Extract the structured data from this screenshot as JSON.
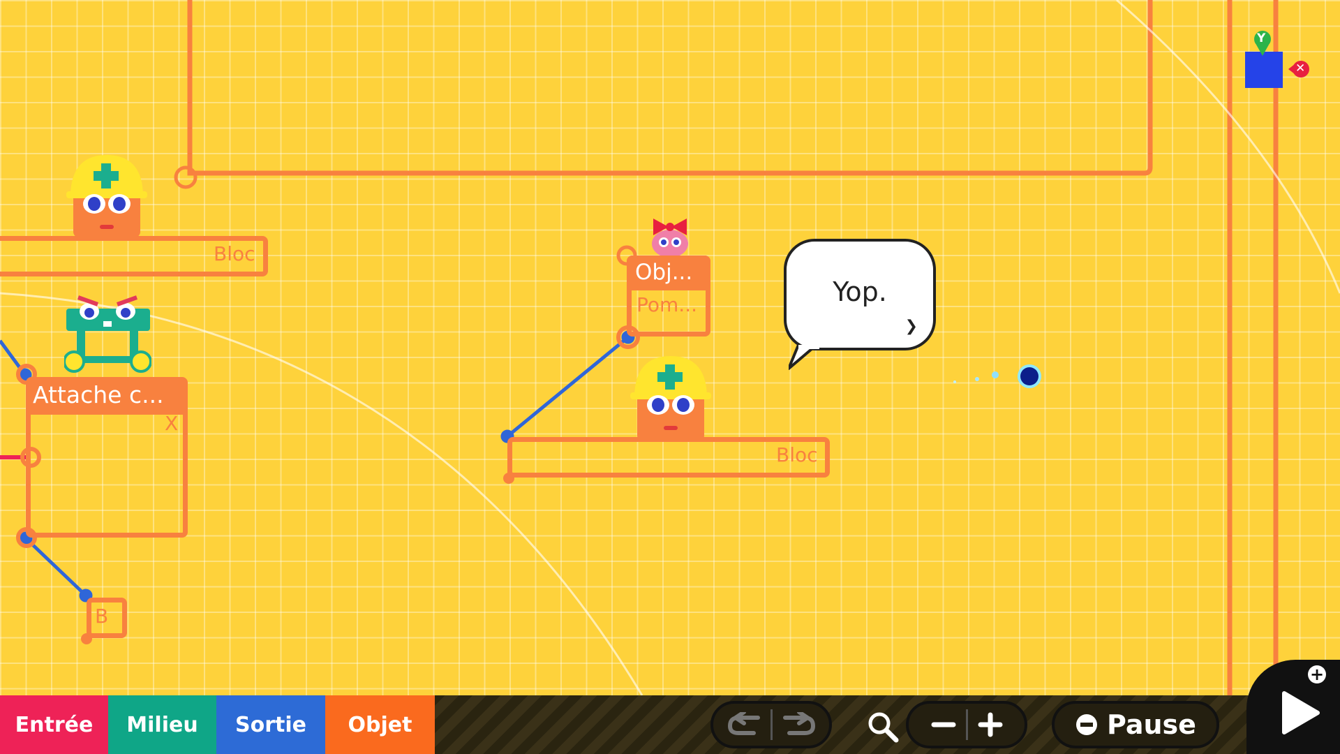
{
  "canvas": {
    "nodes": {
      "bloc_top_left": {
        "label": "Bloc"
      },
      "bloc_center": {
        "label": "Bloc"
      },
      "attache": {
        "title": "Attache c...",
        "sub": "X"
      },
      "objet": {
        "title": "Obj...",
        "sub": "Pom..."
      },
      "b_box": {
        "label": "B"
      }
    },
    "speech_bubble": {
      "text": "Yop."
    },
    "corner_object": {
      "button_y": "Y",
      "button_x": "✕"
    }
  },
  "bottom_bar": {
    "categories": [
      {
        "label": "Entrée",
        "color": "#EE2257"
      },
      {
        "label": "Milieu",
        "color": "#0FA687"
      },
      {
        "label": "Sortie",
        "color": "#2D6BD6"
      },
      {
        "label": "Objet",
        "color": "#FA6A1E"
      }
    ],
    "zoom_icon": "magnifier-icon",
    "pause": {
      "label": "Pause",
      "icon": "minus-circle-icon"
    },
    "play": {
      "icon": "play-icon",
      "badge": "+"
    }
  },
  "colors": {
    "background": "#FED23B",
    "wire": "#F8813F",
    "link": "#2F66D8"
  }
}
